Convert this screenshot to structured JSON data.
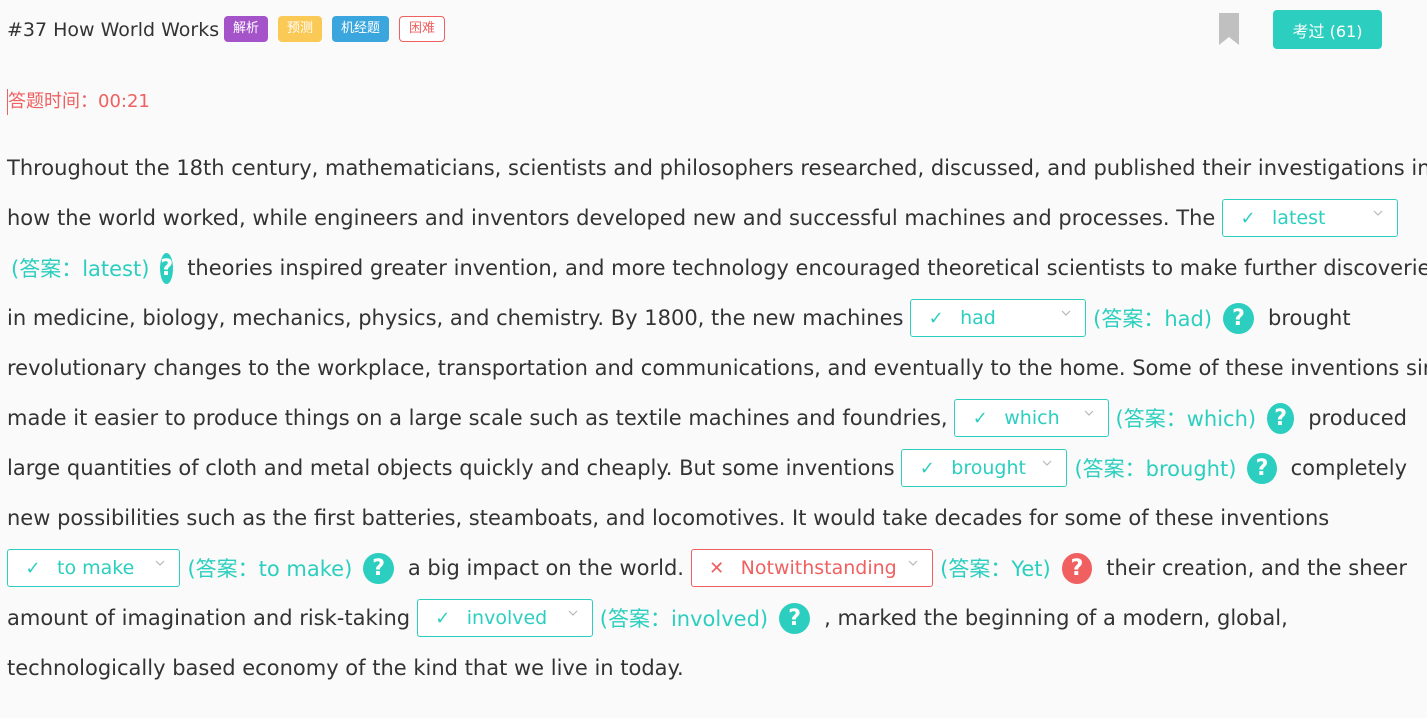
{
  "header": {
    "title": "#37 How World Works",
    "tags": [
      {
        "label": "解析",
        "color": "#a453c9",
        "style": "solid"
      },
      {
        "label": "预测",
        "color": "#fbc956",
        "style": "solid"
      },
      {
        "label": "机经题",
        "color": "#3aa6dd",
        "style": "solid"
      },
      {
        "label": "困难",
        "color": "#f06060",
        "style": "outline"
      }
    ],
    "exam_button": "考过 (61)",
    "bookmark_icon": "bookmark-icon"
  },
  "timer": "答题时间：00:21",
  "colors": {
    "accent": "#2ccfbf",
    "wrong": "#f06060",
    "bookmark": "#c0c0c0"
  },
  "passage": {
    "lines": [
      [
        {
          "t": "text",
          "v": "Throughout the 18th century, mathematicians, scientists and philosophers researched, discussed, and published their investigations into"
        }
      ],
      [
        {
          "t": "text",
          "v": "how the world worked, while engineers and inventors developed new and successful machines and processes. The "
        },
        {
          "t": "blank",
          "value": "latest",
          "correct": true,
          "w": 176
        }
      ],
      [
        {
          "t": "answer",
          "v": "(答案：latest)"
        },
        {
          "t": "help",
          "correct": true
        },
        {
          "t": "text",
          "v": "theories inspired greater invention, and more technology encouraged theoretical scientists to make further discoveries"
        }
      ],
      [
        {
          "t": "text",
          "v": "in medicine, biology, mechanics, physics, and chemistry. By 1800, the new machines "
        },
        {
          "t": "blank",
          "value": "had",
          "correct": true,
          "w": 176
        },
        {
          "t": "answer",
          "v": "(答案：had)"
        },
        {
          "t": "help",
          "correct": true
        },
        {
          "t": "text",
          "v": "brought"
        }
      ],
      [
        {
          "t": "text",
          "v": "revolutionary changes to the workplace, transportation and communications, and eventually to the home. Some of these inventions simply"
        }
      ],
      [
        {
          "t": "text",
          "v": "made it easier to produce things on a large scale such as textile machines and foundries, "
        },
        {
          "t": "blank",
          "value": "which",
          "correct": true,
          "w": 176
        },
        {
          "t": "answer",
          "v": "(答案：which)"
        },
        {
          "t": "help",
          "correct": true
        },
        {
          "t": "text",
          "v": "produced"
        }
      ],
      [
        {
          "t": "text",
          "v": "large quantities of cloth and metal objects quickly and cheaply. But some inventions "
        },
        {
          "t": "blank",
          "value": "brought",
          "correct": true,
          "w": 176
        },
        {
          "t": "answer",
          "v": "(答案：brought)"
        },
        {
          "t": "help",
          "correct": true
        },
        {
          "t": "text",
          "v": "completely"
        }
      ],
      [
        {
          "t": "text",
          "v": "new possibilities such as the first batteries, steamboats, and locomotives. It would take decades for some of these inventions"
        }
      ],
      [
        {
          "t": "blank",
          "value": "to make",
          "correct": true,
          "w": 176
        },
        {
          "t": "answer",
          "v": "(答案：to make)"
        },
        {
          "t": "help",
          "correct": true
        },
        {
          "t": "text",
          "v": "a big impact on the world. "
        },
        {
          "t": "blank",
          "value": "Notwithstanding",
          "correct": false,
          "w": 246
        },
        {
          "t": "answer",
          "v": "(答案：Yet)"
        },
        {
          "t": "help",
          "correct": false
        },
        {
          "t": "text",
          "v": "their creation, and the sheer"
        }
      ],
      [
        {
          "t": "text",
          "v": "amount of imagination and risk-taking "
        },
        {
          "t": "blank",
          "value": "involved",
          "correct": true,
          "w": 176
        },
        {
          "t": "answer",
          "v": "(答案：involved)"
        },
        {
          "t": "help",
          "correct": true
        },
        {
          "t": "text",
          "v": ", marked the beginning of a modern, global,"
        }
      ],
      [
        {
          "t": "text",
          "v": "technologically based economy of the kind that we live in today."
        }
      ]
    ],
    "help_glyph": "?",
    "check_icon": "✓",
    "cross_icon": "✕"
  }
}
